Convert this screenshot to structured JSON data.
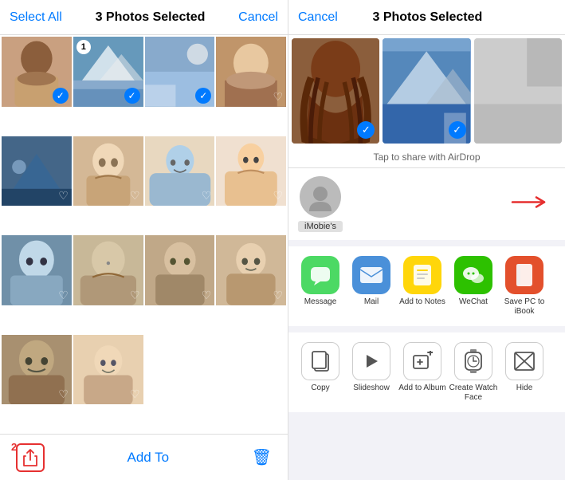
{
  "left": {
    "select_all": "Select All",
    "title": "3 Photos Selected",
    "cancel": "Cancel",
    "toolbar_number": "2",
    "add_to": "Add To"
  },
  "right": {
    "cancel": "Cancel",
    "title": "3 Photos Selected",
    "airdrop_hint": "Tap to share with AirDrop",
    "person_name": "iMobie's",
    "apps": [
      {
        "label": "Message",
        "icon_class": "app-icon-message",
        "icon": "💬"
      },
      {
        "label": "Mail",
        "icon_class": "app-icon-mail",
        "icon": "✉️"
      },
      {
        "label": "Add to Notes",
        "icon_class": "app-icon-notes",
        "icon": "📋"
      },
      {
        "label": "WeChat",
        "icon_class": "app-icon-wechat",
        "icon": "💬"
      },
      {
        "label": "Save PC\nto iBook",
        "icon_class": "app-icon-ibooks",
        "icon": "📖"
      }
    ],
    "actions": [
      {
        "label": "Copy",
        "icon": "⧉"
      },
      {
        "label": "Slideshow",
        "icon": "▶"
      },
      {
        "label": "Add to Album",
        "icon": "＋"
      },
      {
        "label": "Create\nWatch Face",
        "icon": "⌚"
      },
      {
        "label": "Hide",
        "icon": "◫"
      }
    ]
  }
}
